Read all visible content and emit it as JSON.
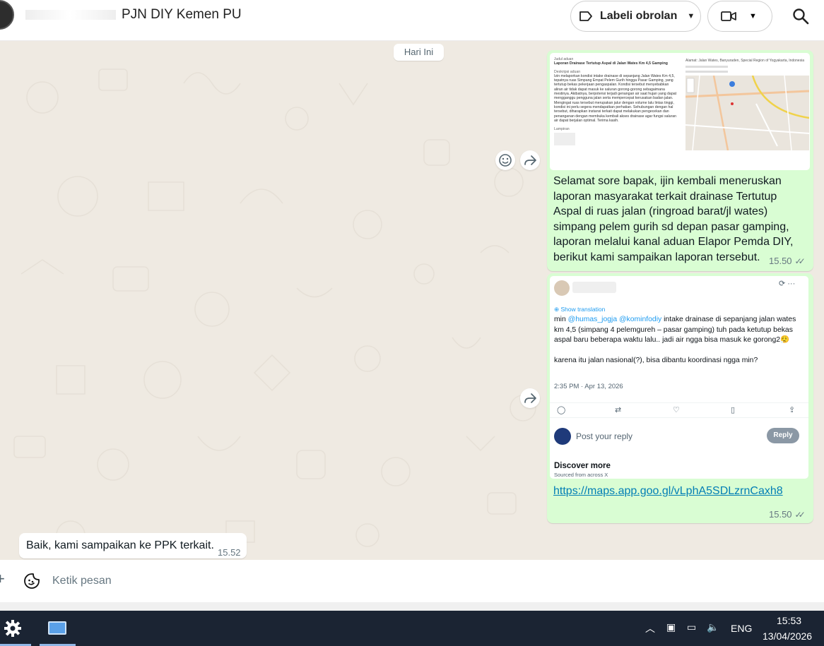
{
  "header": {
    "title": "PJN DIY Kemen PU",
    "label_button": "Labeli obrolan",
    "icons": [
      "tag-icon",
      "chevron-down-icon",
      "video-camera-icon",
      "search-icon"
    ]
  },
  "chat": {
    "date_separator": "Hari Ini",
    "messages": [
      {
        "direction": "outgoing",
        "preview": {
          "heading": "Laporan Drainase Tertutup Aspal di Jalan Wates Km 4,5 Gamping",
          "label_desc": "Deskripsi aduan",
          "body": "Izin melaporkan kondisi intake drainase di sepanjang Jalan Wates Km 4,5, tepatnya ruas Simpang Empat Pelem Gurih hingga Pasar Gamping, yang tertutup bekas pekerjaan pengaspalan. Kondisi tersebut menyebabkan aliran air tidak dapat masuk ke saluran gorong-gorong sebagaimana mestinya. Akibatnya, berpotensi terjadi genangan air saat hujan yang dapat mengganggu pengguna jalan serta mempercepat kerusakan badan jalan. Mengingat ruas tersebut merupakan jalur dengan volume lalu lintas tinggi, kondisi ini perlu segera mendapatkan perhatian. Sehubungan dengan hal tersebut, diharapkan instansi terkait dapat melakukan pengecekan dan penanganan dengan membuka kembali akses drainase agar fungsi saluran air dapat berjalan optimal. Terima kasih.",
          "label_attach": "Lampiran",
          "address": "Alamat: Jalan Wates, Banyuraden, Special Region of Yogyakarta, Indonesia"
        },
        "text": "Selamat sore bapak, ijin kembali meneruskan laporan masyarakat terkait drainase Tertutup Aspal di ruas jalan (ringroad barat/jl wates) simpang pelem gurih sd depan pasar gamping, laporan melalui kanal aduan Elapor Pemda DIY, berikut kami sampaikan laporan tersebut.",
        "time": "15.50"
      },
      {
        "direction": "outgoing",
        "tweet": {
          "show_translation": "Show translation",
          "body_prefix": "min ",
          "mention1": "@humas_jogja",
          "mention2": "@kominfodiy",
          "body_main": " intake drainase di sepanjang jalan wates km 4,5 (simpang 4 pelemgureh – pasar gamping) tuh pada ketutup bekas aspal baru beberapa waktu lalu.. jadi air ngga bisa masuk ke gorong2😮‍💨",
          "body_second": "karena itu jalan nasional(?), bisa dibantu koordinasi ngga min?",
          "timestamp": "2:35 PM · Apr 13, 2026",
          "reply_placeholder": "Post your reply",
          "reply_button": "Reply",
          "discover_title": "Discover more",
          "discover_sub": "Sourced from across X"
        },
        "link": "https://maps.app.goo.gl/vLphA5SDLzrnCaxh8",
        "time": "15.50"
      },
      {
        "direction": "incoming",
        "text": "Baik, kami sampaikan ke PPK terkait.",
        "time": "15.52"
      }
    ]
  },
  "composer": {
    "placeholder": "Ketik pesan"
  },
  "taskbar": {
    "language": "ENG",
    "time": "15:53",
    "date": "13/04/2026"
  },
  "colors": {
    "outgoing_bubble": "#d9fdd3",
    "incoming_bubble": "#ffffff",
    "chat_background": "#efeae2",
    "link": "#027eb5",
    "taskbar": "#1b2433"
  }
}
